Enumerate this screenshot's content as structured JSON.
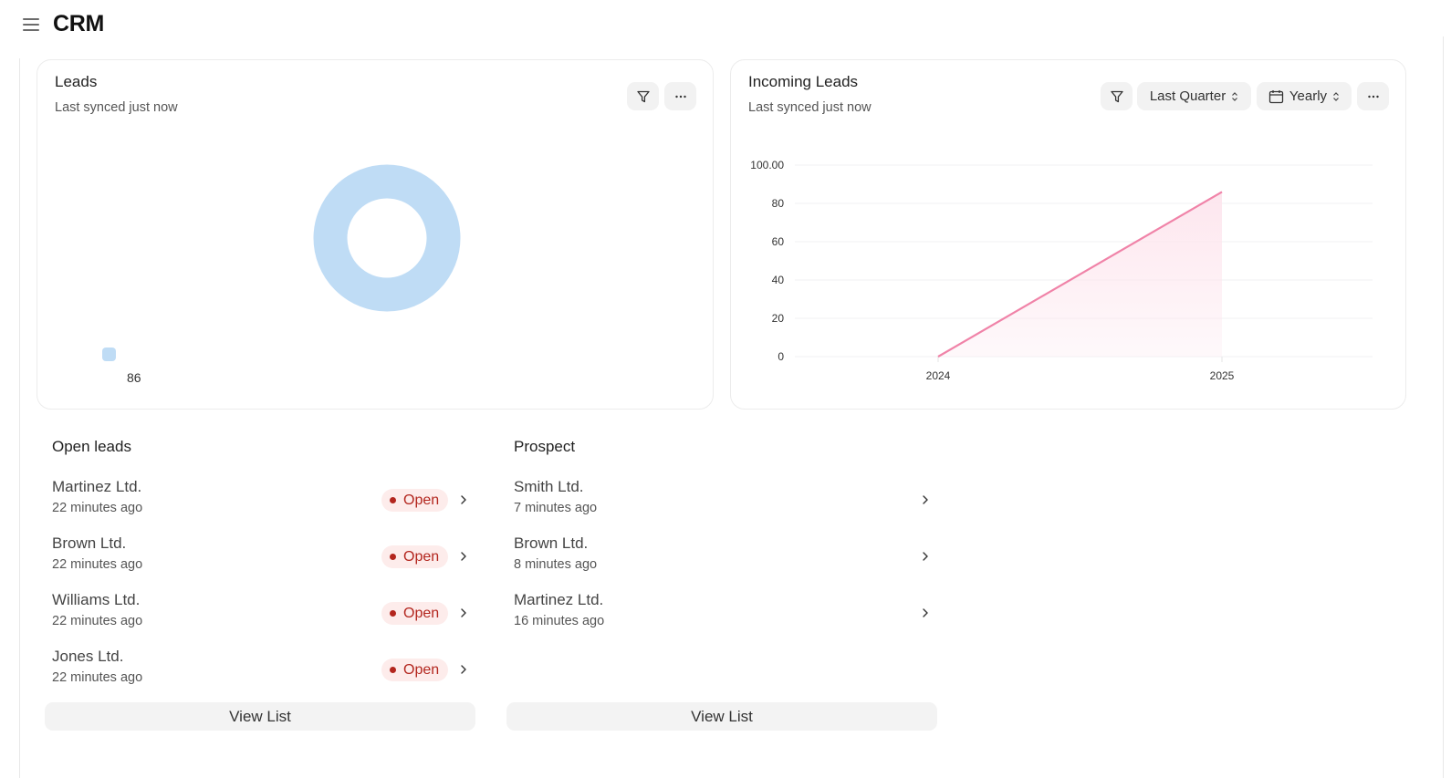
{
  "app": {
    "title": "CRM",
    "menu_icon": "hamburger-icon"
  },
  "leads_card": {
    "title": "Leads",
    "subtitle": "Last synced just now",
    "actions": [
      {
        "icon": "filter-icon"
      },
      {
        "icon": "more-horizontal-icon"
      }
    ],
    "colors": {
      "slice": "#bfdcf5"
    }
  },
  "incoming_card": {
    "title": "Incoming Leads",
    "subtitle": "Last synced just now",
    "filter_icon": "filter-icon",
    "range_select": {
      "value": "Last Quarter",
      "icon": "chevron-up-down-icon"
    },
    "period_select": {
      "value": "Yearly",
      "icon": "calendar-icon"
    },
    "more_icon": "more-horizontal-icon",
    "colors": {
      "line": "#f083a8",
      "fill": "#fde6ee",
      "grid": "#f0f1f3"
    }
  },
  "chart_data": [
    {
      "type": "pie",
      "title": "Leads",
      "variant": "donut",
      "slices": [
        {
          "label": "86",
          "value": 86
        }
      ],
      "legend": [
        "86"
      ],
      "legend_placement": "bottom-left"
    },
    {
      "type": "area",
      "title": "Incoming Leads",
      "x": [
        "2024",
        "2025"
      ],
      "series": [
        {
          "name": "Incoming Leads",
          "values": [
            0,
            86
          ]
        }
      ],
      "yticks": [
        "0",
        "20",
        "40",
        "60",
        "80",
        "100.00"
      ],
      "ylim": [
        0,
        100
      ],
      "grid": true,
      "xlabel": "",
      "ylabel": ""
    }
  ],
  "open_leads": {
    "title": "Open leads",
    "items": [
      {
        "name": "Martinez Ltd.",
        "time": "22 minutes ago",
        "status": "Open"
      },
      {
        "name": "Brown Ltd.",
        "time": "22 minutes ago",
        "status": "Open"
      },
      {
        "name": "Williams Ltd.",
        "time": "22 minutes ago",
        "status": "Open"
      },
      {
        "name": "Jones Ltd.",
        "time": "22 minutes ago",
        "status": "Open"
      }
    ],
    "view_list_label": "View List"
  },
  "prospect": {
    "title": "Prospect",
    "items": [
      {
        "name": "Smith Ltd.",
        "time": "7 minutes ago"
      },
      {
        "name": "Brown Ltd.",
        "time": "8 minutes ago"
      },
      {
        "name": "Martinez Ltd.",
        "time": "16 minutes ago"
      }
    ],
    "view_list_label": "View List"
  }
}
